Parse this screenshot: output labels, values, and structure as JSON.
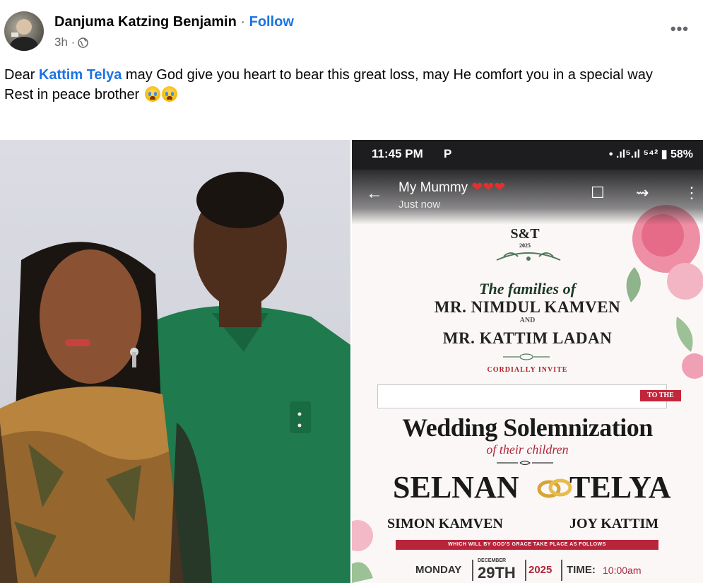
{
  "post": {
    "author": "Danjuma Katzing Benjamin",
    "separator": "·",
    "follow_label": "Follow",
    "time": "3h ·",
    "more_label": "•••",
    "text_before_mention": "Dear ",
    "mention": "Kattim Telya",
    "text_after_mention": " may God give you heart to bear this great loss, may He comfort you in a special way",
    "line2": "Rest in peace brother"
  },
  "phone": {
    "time": "11:45 PM",
    "app_letter": "P",
    "indicators": "• .ıl⁵.ıl ⁵⁴² ▮ 58%",
    "chat_name": "My Mummy",
    "chat_hearts": "❤❤❤",
    "chat_status": "Just now",
    "back_icon": "←",
    "bookmark_icon": "☐",
    "forward_icon": "⇝",
    "menu_icon": "⋮"
  },
  "invitation": {
    "monogram": "S&T",
    "monogram_year": "2025",
    "families_of": "The families of",
    "family1": "MR. NIMDUL KAMVEN",
    "and": "AND",
    "family2": "MR. KATTIM LADAN",
    "cordially": "CORDIALLY INVITE",
    "to_the": "TO THE",
    "event": "Wedding Solemnization",
    "of_children": "of their children",
    "surname1": "SELNAN",
    "surname2": "TELYA",
    "name1": "SIMON KAMVEN",
    "name2": "JOY KATTIM",
    "banner": "WHICH WILL BY GOD'S GRACE TAKE PLACE AS FOLLOWS",
    "day": "MONDAY",
    "month": "DECEMBER",
    "date": "29TH",
    "year": "2025",
    "time_label": "TIME:",
    "time_value": "10:00am"
  }
}
